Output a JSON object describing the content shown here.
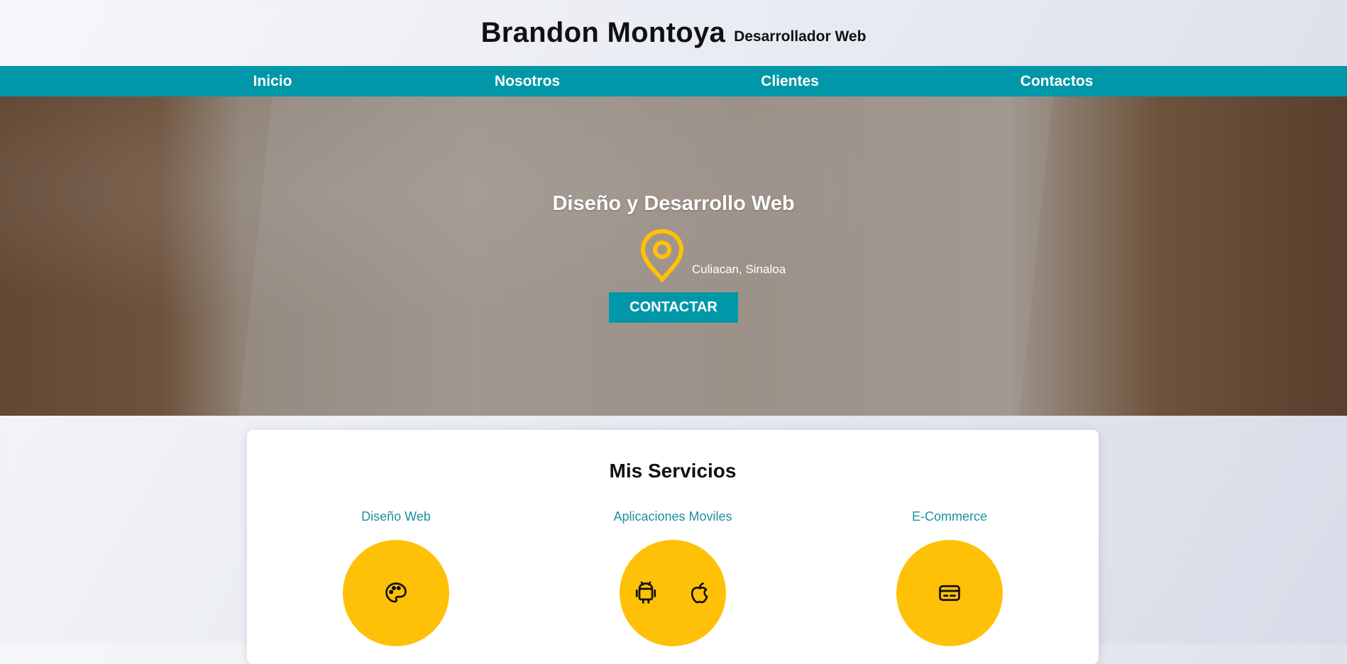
{
  "header": {
    "title": "Brandon Montoya",
    "subtitle": "Desarrollador Web"
  },
  "nav": {
    "items": [
      "Inicio",
      "Nosotros",
      "Clientes",
      "Contactos"
    ]
  },
  "hero": {
    "title": "Diseño y Desarrollo Web",
    "location": "Culiacan, Sinaloa",
    "button_label": "CONTACTAR"
  },
  "services": {
    "title": "Mis Servicios",
    "items": [
      {
        "name": "Diseño Web",
        "icons": [
          "palette-icon"
        ]
      },
      {
        "name": "Aplicaciones Moviles",
        "icons": [
          "android-icon",
          "apple-icon"
        ]
      },
      {
        "name": "E-Commerce",
        "icons": [
          "credit-card-icon"
        ]
      }
    ]
  },
  "colors": {
    "accent": "#0097a8",
    "highlight": "#ffc107"
  }
}
